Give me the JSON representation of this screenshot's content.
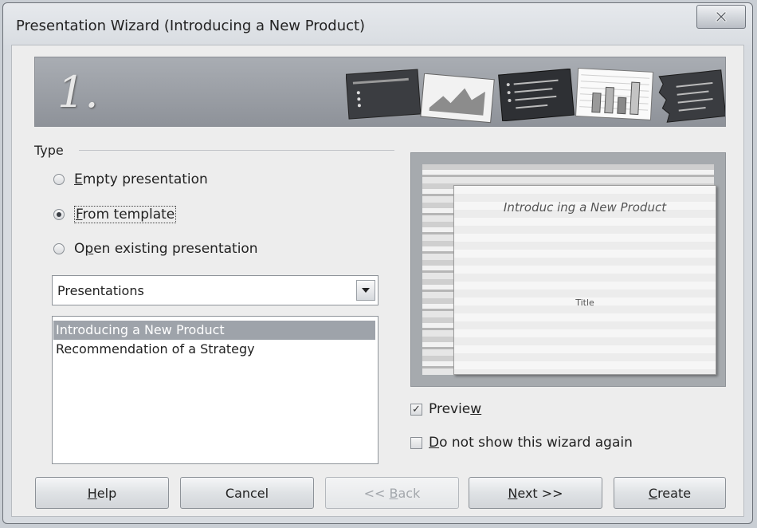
{
  "window": {
    "title": "Presentation Wizard (Introducing a New Product)",
    "close_glyph": "✕"
  },
  "banner": {
    "step": "1."
  },
  "type_group": {
    "title": "Type",
    "options": [
      {
        "pre": "",
        "mnemonic": "E",
        "post": "mpty presentation",
        "checked": false
      },
      {
        "pre": "",
        "mnemonic": "F",
        "post": "rom template",
        "checked": true
      },
      {
        "pre": "O",
        "mnemonic": "p",
        "post": "en existing presentation",
        "checked": false
      }
    ]
  },
  "category_combo": {
    "value": "Presentations",
    "arrow_icon": "chevron-down-icon"
  },
  "template_list": {
    "items": [
      "Introducing a New Product",
      "Recommendation of a Strategy"
    ],
    "selected_index": 0
  },
  "preview_slide": {
    "title": "Introduc ing a New Product",
    "subtitle": "Title"
  },
  "checkboxes": {
    "preview": {
      "pre": "Previe",
      "mnemonic": "w",
      "post": "",
      "checked": true,
      "mark": "✓"
    },
    "dont_show": {
      "pre": "",
      "mnemonic": "D",
      "post": "o not show this wizard again",
      "checked": false
    }
  },
  "buttons": {
    "help": {
      "pre": "",
      "mnemonic": "H",
      "post": "elp"
    },
    "cancel": {
      "label": "Cancel"
    },
    "back": {
      "pre": "<< ",
      "mnemonic": "B",
      "post": "ack",
      "enabled": false
    },
    "next": {
      "pre": "",
      "mnemonic": "N",
      "post": "ext >>"
    },
    "create": {
      "pre": "",
      "mnemonic": "C",
      "post": "reate"
    }
  }
}
